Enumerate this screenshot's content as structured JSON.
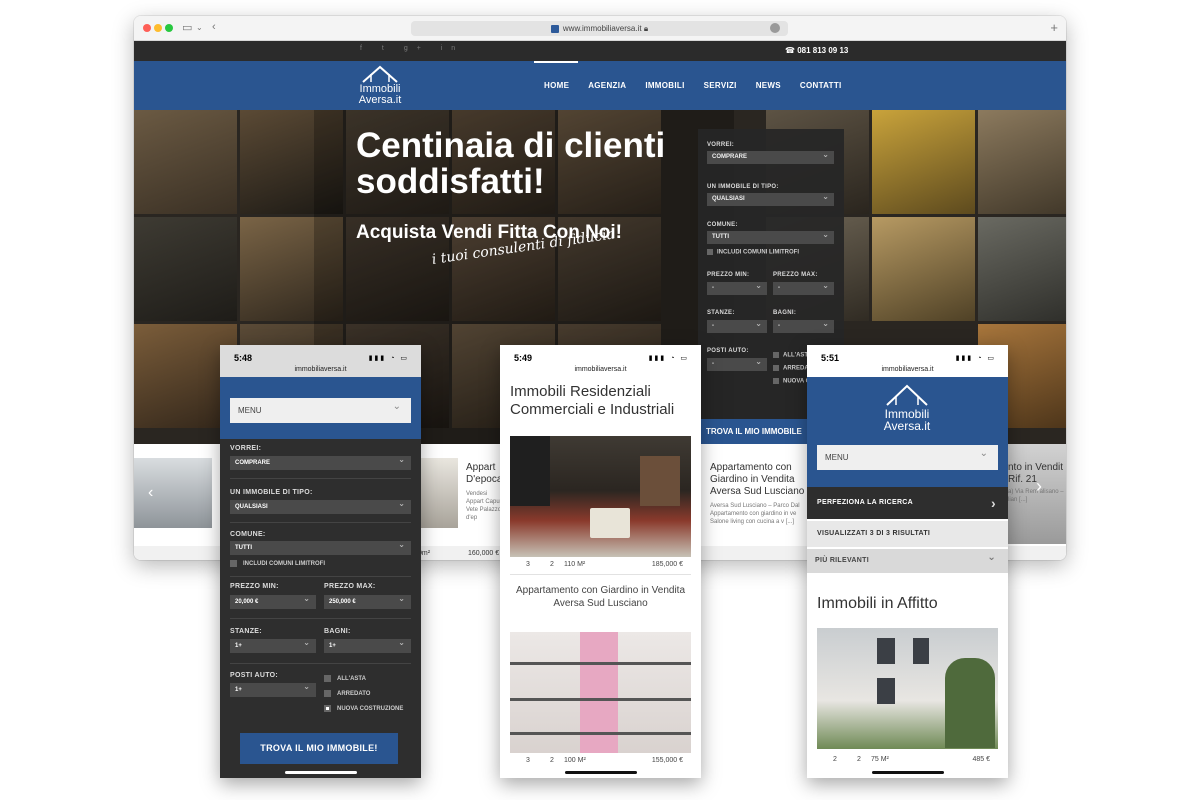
{
  "browser": {
    "url": "www.immobiliaversa.it",
    "social_icons": [
      "f",
      "t",
      "g+",
      "in"
    ],
    "phone": "☎ 081 813 09 13",
    "logo": {
      "line1": "Immobili",
      "line2": "Aversa.it"
    },
    "nav": [
      "HOME",
      "AGENZIA",
      "IMMOBILI",
      "SERVIZI",
      "NEWS",
      "CONTATTI"
    ],
    "hero": {
      "title": "Centinaia di clienti soddisfatti!",
      "subtitle": "Acquista Vendi Fitta Con Noi!",
      "script": "i tuoi consulenti di fiducia"
    },
    "search": {
      "vorrei_label": "VORREI:",
      "vorrei_value": "COMPRARE",
      "tipo_label": "UN IMMOBILE DI TIPO:",
      "tipo_value": "QUALSIASI",
      "comune_label": "COMUNE:",
      "comune_value": "TUTTI",
      "limitrofi": "INCLUDI COMUNI LIMITROFI",
      "prezzo_min_label": "PREZZO MIN:",
      "prezzo_min_value": "-",
      "prezzo_max_label": "PREZZO MAX:",
      "prezzo_max_value": "-",
      "stanze_label": "STANZE:",
      "stanze_value": "-",
      "bagni_label": "BAGNI:",
      "bagni_value": "-",
      "posti_label": "POSTI AUTO:",
      "posti_value": "-",
      "all_asta": "ALL'ASTA",
      "arredato": "ARREDA",
      "nuova": "NUOVA COSTRUZIO",
      "button": "TROVA IL MIO IMMOBILE"
    },
    "listings": [
      {
        "title": "Appart D'epoca",
        "desc": "Vendesi Appart Capua Vete Palazzo d'ep",
        "area": "0m²",
        "price": "160,000 €"
      },
      {
        "title": "Appartamento con Giardino in Vendita Aversa Sud Lusciano",
        "desc": "Aversa Sud Lusciano – Parco Dal Appartamento con giardino in ve Salone living con cucina a v [...]"
      },
      {
        "title": "nto in Vendit Rif. 21",
        "desc": "a) Via Rem alisano – lian [...]"
      }
    ]
  },
  "phone1": {
    "time": "5:48",
    "url": "immobiliaversa.it",
    "menu": "MENU",
    "vorrei_label": "VORREI:",
    "vorrei_value": "COMPRARE",
    "tipo_label": "UN IMMOBILE DI TIPO:",
    "tipo_value": "QUALSIASI",
    "comune_label": "COMUNE:",
    "comune_value": "TUTTI",
    "limitrofi": "INCLUDI COMUNI LIMITROFI",
    "prezzo_min_label": "PREZZO MIN:",
    "prezzo_min_value": "20,000 €",
    "prezzo_max_label": "PREZZO MAX:",
    "prezzo_max_value": "250,000 €",
    "stanze_label": "STANZE:",
    "stanze_value": "1+",
    "bagni_label": "BAGNI:",
    "bagni_value": "1+",
    "posti_label": "POSTI AUTO:",
    "posti_value": "1+",
    "all_asta": "ALL'ASTA",
    "arredato": "ARREDATO",
    "nuova": "NUOVA COSTRUZIONE",
    "button": "TROVA IL MIO IMMOBILE!"
  },
  "phone2": {
    "time": "5:49",
    "url": "immobiliaversa.it",
    "heading": "Immobili Residenziali Commerciali e Industriali",
    "card1": {
      "rooms": "3",
      "baths": "2",
      "area": "110 M²",
      "price": "185,000 €",
      "caption": "Appartamento con Giardino in Vendita Aversa Sud Lusciano"
    },
    "card2": {
      "rooms": "3",
      "baths": "2",
      "area": "100 M²",
      "price": "155,000 €"
    }
  },
  "phone3": {
    "time": "5:51",
    "url": "immobiliaversa.it",
    "logo": {
      "line1": "Immobili",
      "line2": "Aversa.it"
    },
    "menu": "MENU",
    "refine": "PERFEZIONA LA RICERCA",
    "count": "VISUALIZZATI 3 DI 3 RISULTATI",
    "sort": "PIÙ RILEVANTI",
    "heading": "Immobili in Affitto",
    "card": {
      "rooms": "2",
      "baths": "2",
      "area": "75 M²",
      "price": "485 €"
    }
  },
  "colors": {
    "brand_blue": "#2a5590",
    "dark_panel": "#2e2e2e",
    "topbar": "#2b2b2b"
  }
}
